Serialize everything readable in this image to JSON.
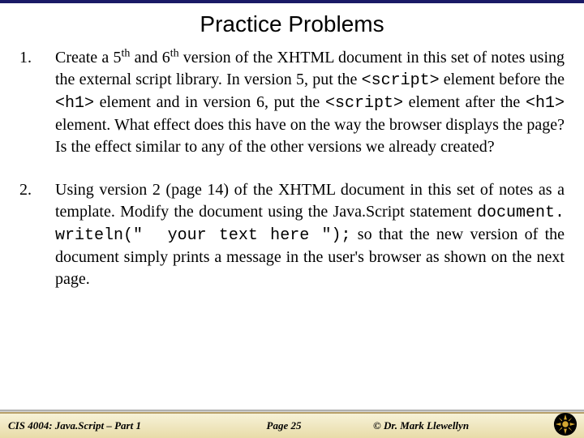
{
  "title": "Practice Problems",
  "items": [
    {
      "num": "1.",
      "html": "Create a 5<sup>th</sup> and 6<sup>th</sup> version of the XHTML document in this set of notes using the external script library.  In version 5, put the <span class=\"mono\">&lt;script&gt;</span> element before the <span class=\"mono\">&lt;h1&gt;</span> element and in version 6, put the <span class=\"mono\">&lt;script&gt;</span> element after the <span class=\"mono\">&lt;h1&gt;</span> element. What effect does this have on the way the browser displays the page?  Is the effect similar to any of the other versions we already created?"
    },
    {
      "num": "2.",
      "html": "Using version 2 (page 14) of the XHTML document in this set of notes as a template.  Modify the document using the Java.Script statement <span class=\"mono\">document. writeln(\" &nbsp;your text here \");</span> so that the new version of the document simply prints a message in the user's browser as shown on the next page."
    }
  ],
  "footer": {
    "left": "CIS 4004: Java.Script – Part 1",
    "center": "Page 25",
    "right": "© Dr. Mark Llewellyn"
  },
  "logo": {
    "name": "ucf-pegasus-logo",
    "bg": "#000000",
    "fg": "#d4a731"
  }
}
